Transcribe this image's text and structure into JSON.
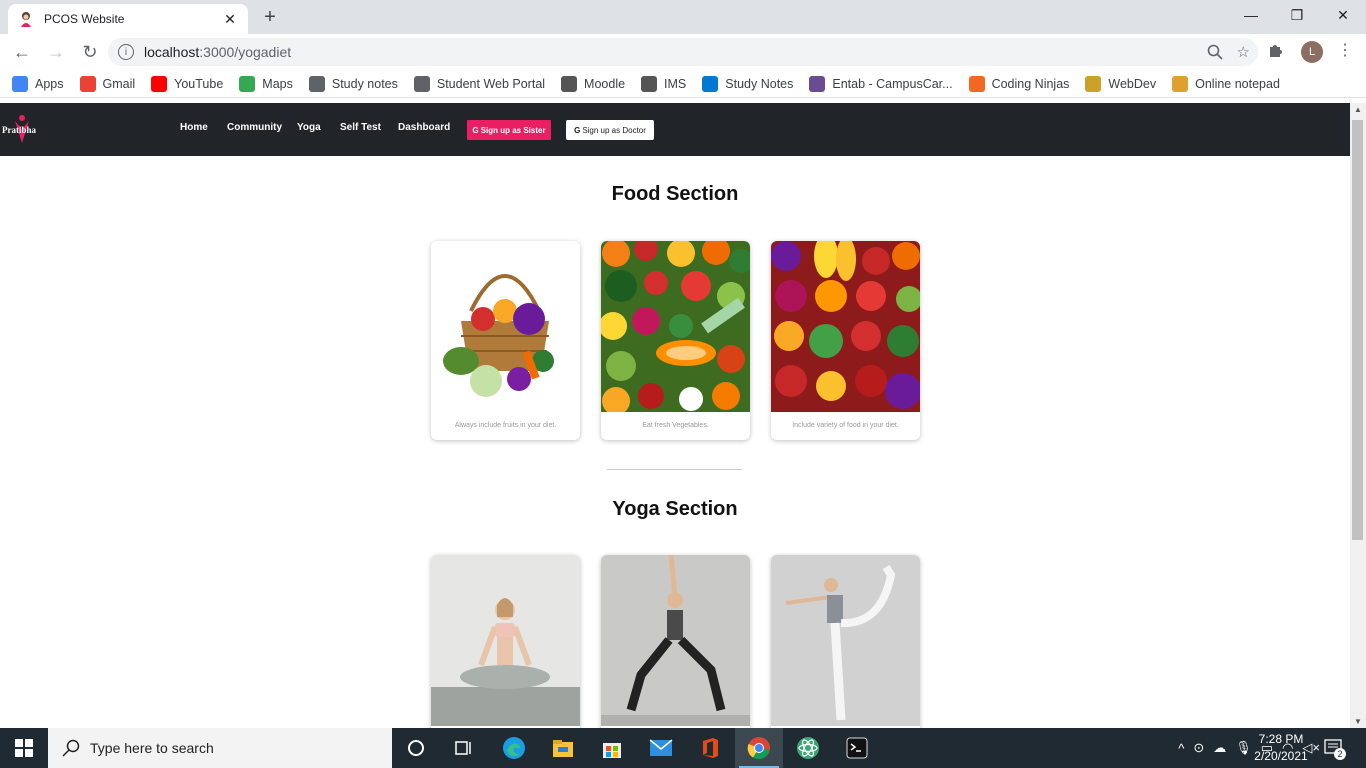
{
  "browser": {
    "tab_title": "PCOS Website",
    "url_host": "localhost",
    "url_path": ":3000/yogadiet",
    "bookmarks": [
      {
        "label": "Apps",
        "icon": "apps-grid-icon",
        "color": "#4285f4"
      },
      {
        "label": "Gmail",
        "icon": "gmail-icon",
        "color": "#ea4335"
      },
      {
        "label": "YouTube",
        "icon": "youtube-icon",
        "color": "#ff0000"
      },
      {
        "label": "Maps",
        "icon": "maps-icon",
        "color": "#34a853"
      },
      {
        "label": "Study notes",
        "icon": "globe-icon",
        "color": "#5f6368"
      },
      {
        "label": "Student Web Portal",
        "icon": "globe-icon",
        "color": "#5f6368"
      },
      {
        "label": "Moodle",
        "icon": "moodle-icon",
        "color": "#555555"
      },
      {
        "label": "IMS",
        "icon": "moodle-icon",
        "color": "#555555"
      },
      {
        "label": "Study Notes",
        "icon": "onedrive-icon",
        "color": "#0078d4"
      },
      {
        "label": "Entab - CampusCar...",
        "icon": "entab-icon",
        "color": "#6a4c93"
      },
      {
        "label": "Coding Ninjas",
        "icon": "coding-ninjas-icon",
        "color": "#f26722"
      },
      {
        "label": "WebDev",
        "icon": "webdev-icon",
        "color": "#c9a227"
      },
      {
        "label": "Online notepad",
        "icon": "notepad-icon",
        "color": "#e0a030"
      }
    ],
    "avatar_letter": "L"
  },
  "site": {
    "logo_text": "Pratibha",
    "nav": [
      "Home",
      "Community",
      "Yoga",
      "Self Test",
      "Dashboard"
    ],
    "signup_sister": "Sign up as Sister",
    "signup_doctor": "Sign up as Doctor",
    "brand_color": "#e91e63"
  },
  "food": {
    "title": "Food Section",
    "cards": [
      {
        "caption": "Always include fruits in your diet.",
        "image": "vegetable-basket-image"
      },
      {
        "caption": "Eat fresh Vegetables.",
        "image": "fruits-vegetables-spread-image"
      },
      {
        "caption": "Include variety of food in your diet.",
        "image": "colorful-produce-image"
      }
    ]
  },
  "yoga": {
    "title": "Yoga Section",
    "cards": [
      {
        "image": "lotus-pose-image"
      },
      {
        "image": "warrior-pose-image"
      },
      {
        "image": "dancer-pose-image"
      }
    ]
  },
  "taskbar": {
    "search_placeholder": "Type here to search",
    "time": "7:28 PM",
    "date": "2/20/2021",
    "notifications": "2"
  }
}
